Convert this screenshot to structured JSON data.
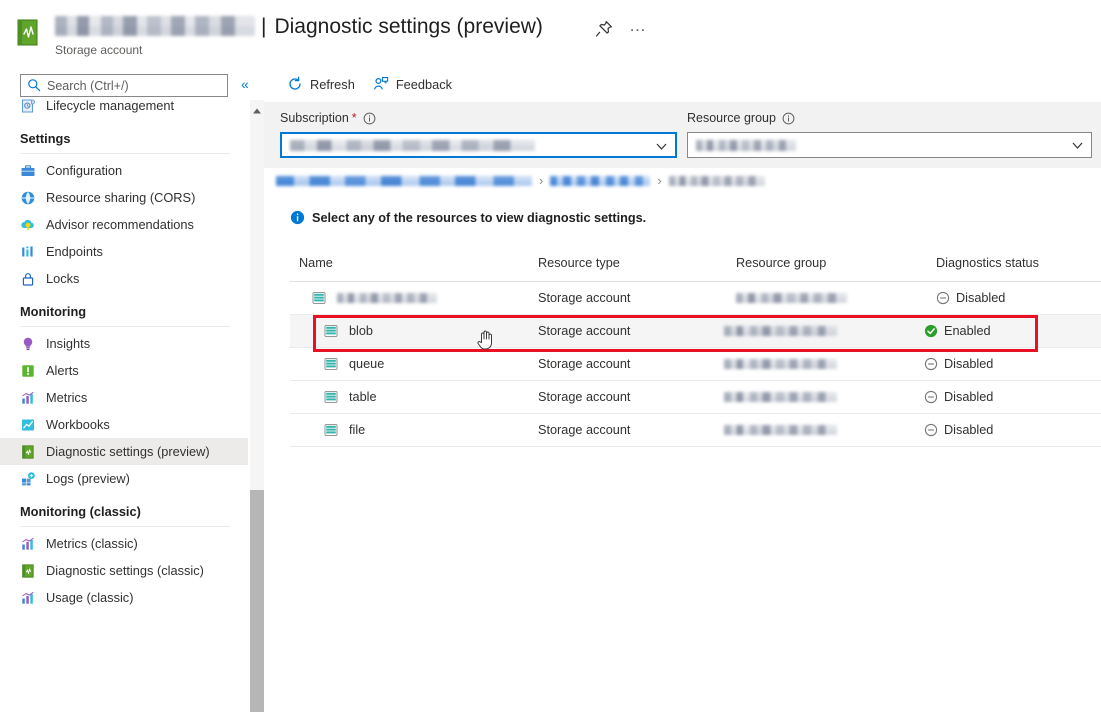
{
  "header": {
    "resource_name_redacted": true,
    "separator": "|",
    "page_title": "Diagnostic settings (preview)",
    "subtitle": "Storage account",
    "title_icon": "diagnostic-settings-book-icon",
    "pin_icon": "pin-icon",
    "ellipsis_label": "…"
  },
  "sidebar": {
    "search": {
      "placeholder": "Search (Ctrl+/)",
      "value": "",
      "icon": "search-icon"
    },
    "collapse_icon": "«",
    "top_items": [
      {
        "label": "Lifecycle management",
        "icon": "lifecycle-management-icon",
        "selected": false
      }
    ],
    "groups": [
      {
        "label": "Settings",
        "items": [
          {
            "label": "Configuration",
            "icon": "configuration-icon",
            "selected": false
          },
          {
            "label": "Resource sharing (CORS)",
            "icon": "cors-icon",
            "selected": false
          },
          {
            "label": "Advisor recommendations",
            "icon": "advisor-icon",
            "selected": false
          },
          {
            "label": "Endpoints",
            "icon": "endpoints-icon",
            "selected": false
          },
          {
            "label": "Locks",
            "icon": "lock-icon",
            "selected": false
          }
        ]
      },
      {
        "label": "Monitoring",
        "items": [
          {
            "label": "Insights",
            "icon": "insights-bulb-icon",
            "selected": false
          },
          {
            "label": "Alerts",
            "icon": "alerts-icon",
            "selected": false
          },
          {
            "label": "Metrics",
            "icon": "metrics-chart-icon",
            "selected": false
          },
          {
            "label": "Workbooks",
            "icon": "workbooks-icon",
            "selected": false
          },
          {
            "label": "Diagnostic settings (preview)",
            "icon": "diagnostic-settings-icon",
            "selected": true
          },
          {
            "label": "Logs (preview)",
            "icon": "logs-icon",
            "selected": false
          }
        ]
      },
      {
        "label": "Monitoring (classic)",
        "items": [
          {
            "label": "Metrics (classic)",
            "icon": "metrics-chart-icon",
            "selected": false
          },
          {
            "label": "Diagnostic settings (classic)",
            "icon": "diagnostic-settings-icon",
            "selected": false
          },
          {
            "label": "Usage (classic)",
            "icon": "metrics-chart-icon",
            "selected": false
          }
        ]
      }
    ]
  },
  "command_bar": {
    "buttons": [
      {
        "label": "Refresh",
        "icon": "refresh-icon"
      },
      {
        "label": "Feedback",
        "icon": "feedback-person-icon"
      }
    ]
  },
  "filters": {
    "subscription": {
      "label": "Subscription",
      "required_marker": "*",
      "info_icon": "info-icon",
      "value_redacted": true,
      "chevron_icon": "chevron-down-icon",
      "focused": true
    },
    "resource_group": {
      "label": "Resource group",
      "info_icon": "info-icon",
      "value_redacted": true,
      "chevron_icon": "chevron-down-icon",
      "focused": false
    }
  },
  "breadcrumb": {
    "separator": "›",
    "segments": [
      {
        "redacted": true,
        "type": "link"
      },
      {
        "redacted": true,
        "type": "link"
      },
      {
        "redacted": true,
        "type": "current"
      }
    ]
  },
  "notice": {
    "icon": "info-icon",
    "text": "Select any of the resources to view diagnostic settings."
  },
  "table": {
    "columns": [
      "Name",
      "Resource type",
      "Resource group",
      "Diagnostics status"
    ],
    "rows": [
      {
        "name": "",
        "name_redacted": true,
        "resource_type": "Storage account",
        "resource_group_redacted": true,
        "status": "Disabled",
        "status_icon": "disabled-circle-icon",
        "highlighted": false,
        "indent": false
      },
      {
        "name": "blob",
        "name_redacted": false,
        "resource_type": "Storage account",
        "resource_group_redacted": true,
        "status": "Enabled",
        "status_icon": "enabled-check-icon",
        "highlighted": true,
        "indent": true
      },
      {
        "name": "queue",
        "name_redacted": false,
        "resource_type": "Storage account",
        "resource_group_redacted": true,
        "status": "Disabled",
        "status_icon": "disabled-circle-icon",
        "highlighted": false,
        "indent": true
      },
      {
        "name": "table",
        "name_redacted": false,
        "resource_type": "Storage account",
        "resource_group_redacted": true,
        "status": "Disabled",
        "status_icon": "disabled-circle-icon",
        "highlighted": false,
        "indent": true
      },
      {
        "name": "file",
        "name_redacted": false,
        "resource_type": "Storage account",
        "resource_group_redacted": true,
        "status": "Disabled",
        "status_icon": "disabled-circle-icon",
        "highlighted": false,
        "indent": true
      }
    ]
  },
  "annotation": {
    "type": "red-rectangle-highlight",
    "target_row": "blob",
    "color": "#e81123"
  },
  "cursor": {
    "type": "hand-pointer"
  },
  "colors": {
    "accent": "#0078d4",
    "enabled_green": "#107c10",
    "disabled_gray": "#737373",
    "annotation_red": "#e81123",
    "storage_icon_teal": "#31b5ad",
    "filter_bar_bg": "#f2f2f2",
    "selected_nav_bg": "#edebe9"
  }
}
